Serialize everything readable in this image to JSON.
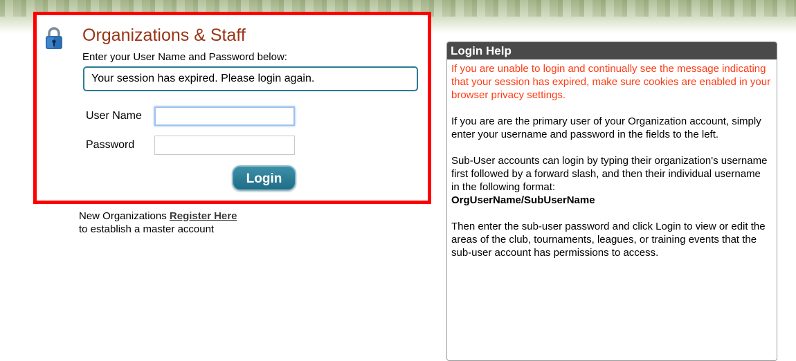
{
  "login": {
    "title": "Organizations & Staff",
    "instructions": "Enter your User Name and Password below:",
    "session_message": "Your session has expired. Please login again.",
    "username_label": "User Name",
    "username_value": "",
    "password_label": "Password",
    "password_value": "",
    "login_button": "Login"
  },
  "register": {
    "prefix": "New Organizations ",
    "link": "Register Here",
    "suffix": "to establish a master account"
  },
  "help": {
    "header": "Login Help",
    "warning": "If you are unable to login and continually see the message indicating that your session has expired, make sure cookies are enabled in your browser privacy settings.",
    "primary": "If you are are the primary user of your Organization account, simply enter your username and password in the fields to the left.",
    "subuser": "Sub-User accounts can login by typing their organization's username first followed by a forward slash, and then their individual username in the following format:",
    "format": "OrgUserName/SubUserName",
    "then": "Then enter the sub-user password and click Login to view or edit the areas of the club, tournaments, leagues, or training events that the sub-user account has permissions to access."
  },
  "colors": {
    "title": "#9a3416",
    "warning": "#ff3a12",
    "accent": "#1f6c86",
    "highlight_border": "#ff0000",
    "help_header": "#4a4a4a"
  },
  "icons": {
    "lock": "lock-icon"
  }
}
